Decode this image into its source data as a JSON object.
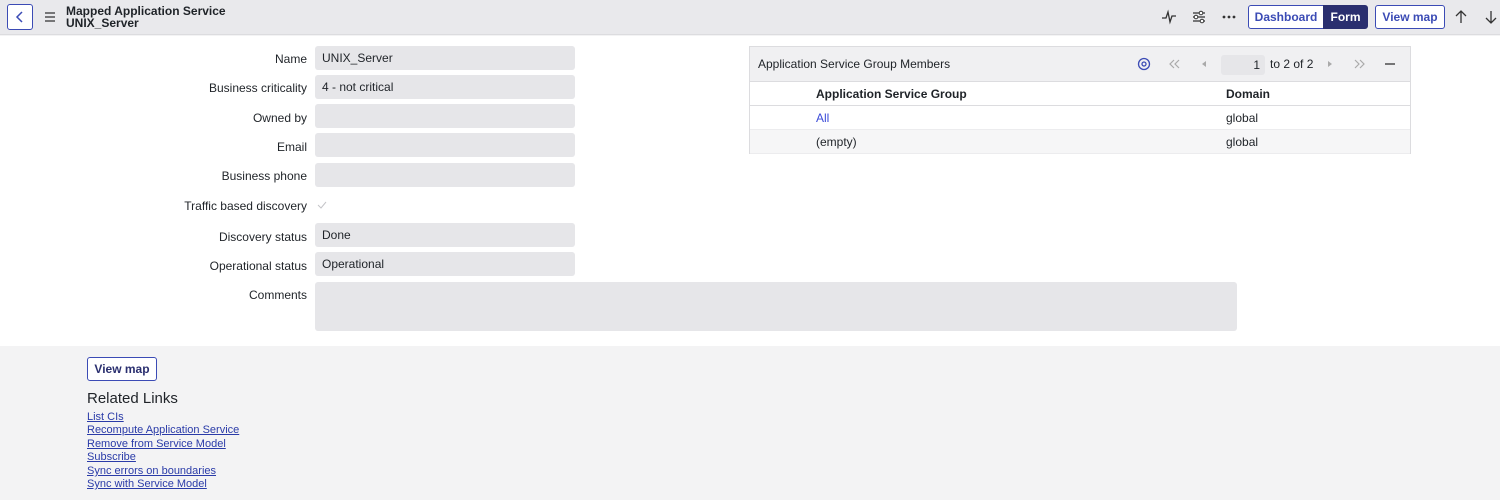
{
  "header": {
    "title_line1": "Mapped Application Service",
    "title_line2": "UNIX_Server",
    "buttons": {
      "dashboard": "Dashboard",
      "form": "Form",
      "view_map": "View map"
    },
    "icons": [
      "back-icon",
      "menu-icon",
      "activity-icon",
      "settings-sliders-icon",
      "more-icon",
      "arrow-up-icon",
      "arrow-down-icon"
    ]
  },
  "form": {
    "fields": [
      {
        "label": "Name",
        "value": "UNIX_Server"
      },
      {
        "label": "Business criticality",
        "value": "4 - not critical"
      },
      {
        "label": "Owned by",
        "value": ""
      },
      {
        "label": "Email",
        "value": ""
      },
      {
        "label": "Business phone",
        "value": ""
      },
      {
        "label": "Traffic based discovery",
        "value": ""
      },
      {
        "label": "Discovery status",
        "value": "Done"
      },
      {
        "label": "Operational status",
        "value": "Operational"
      },
      {
        "label": "Comments",
        "value": ""
      }
    ]
  },
  "related_list": {
    "title": "Application Service Group Members",
    "page_current": "1",
    "page_text": "to 2 of 2",
    "columns": [
      "Application Service Group",
      "Domain"
    ],
    "rows": [
      {
        "group": "All",
        "domain": "global"
      },
      {
        "group": "(empty)",
        "domain": "global"
      }
    ]
  },
  "bottom": {
    "view_map": "View map",
    "related_links_title": "Related Links",
    "links": [
      "List CIs",
      "Recompute Application Service",
      "Remove from Service Model",
      "Subscribe",
      "Sync errors on boundaries",
      "Sync with Service Model"
    ]
  },
  "colors": {
    "accent": "#3b4bb5",
    "primary_dark": "#2a2f6f",
    "field_bg": "#e6e6e9",
    "link": "#2a3ba8"
  }
}
